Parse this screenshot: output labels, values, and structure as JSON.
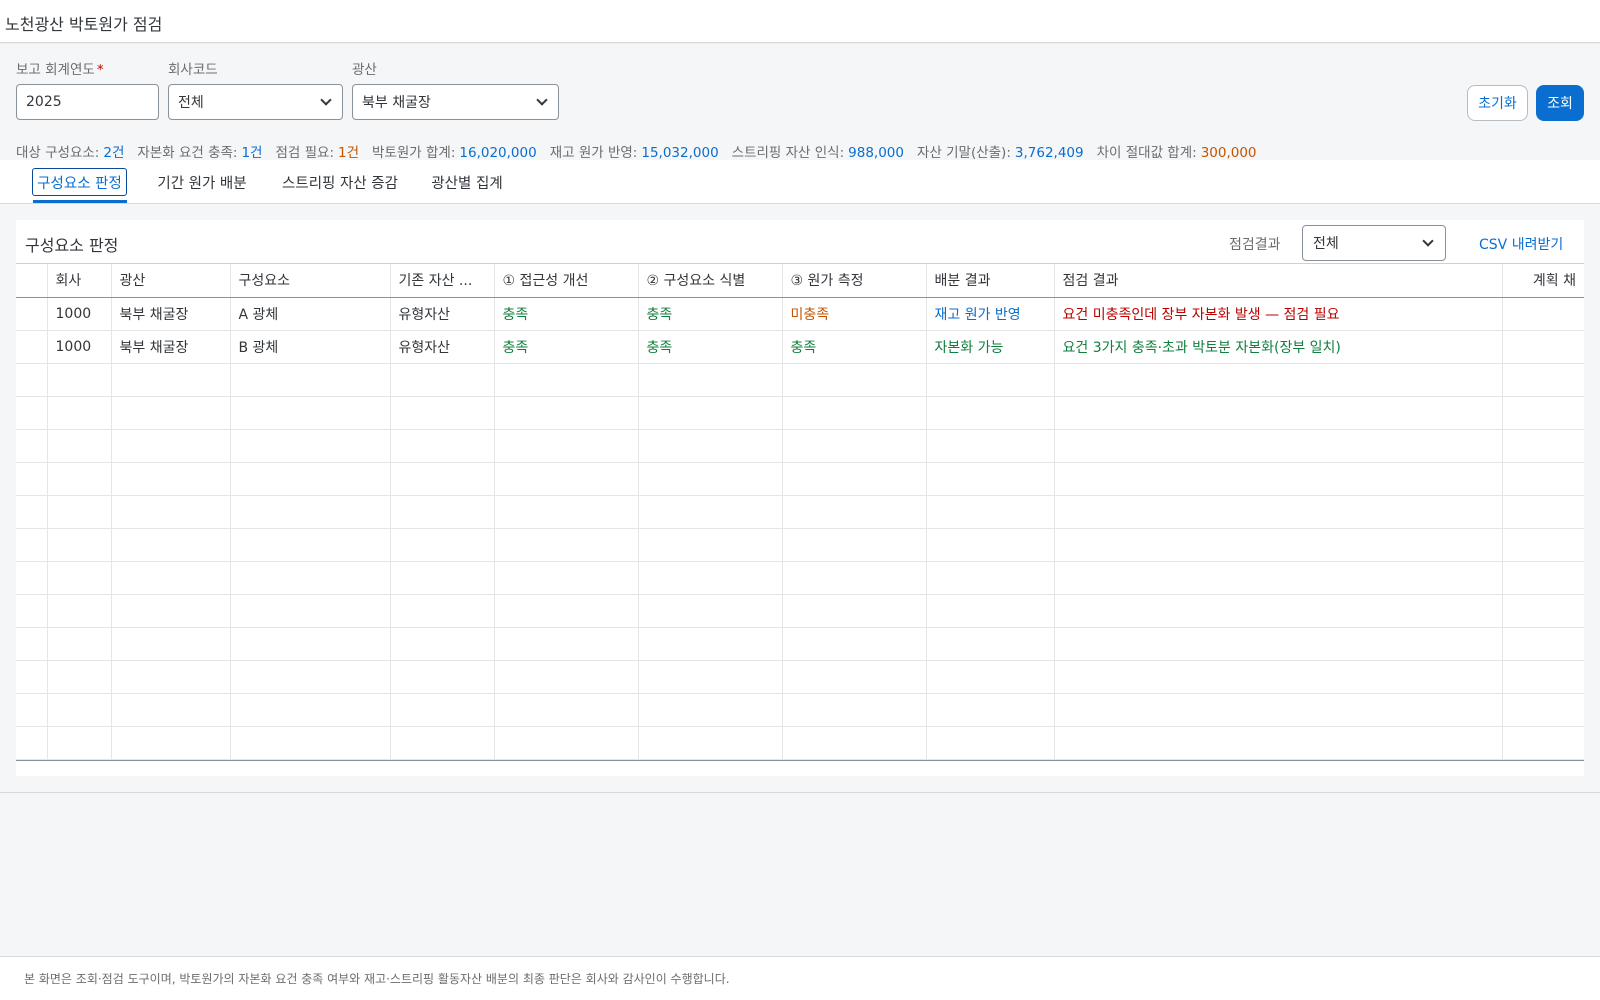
{
  "app": {
    "title": "노천광산 박토원가 점검"
  },
  "filters": {
    "year": {
      "label": "보고 회계연도",
      "required_mark": "*",
      "value": "2025"
    },
    "company": {
      "label": "회사코드",
      "value": "전체"
    },
    "mine": {
      "label": "광산",
      "value": "북부 채굴장"
    }
  },
  "actions": {
    "reset": "초기화",
    "go": "조회"
  },
  "summary": [
    {
      "label": "대상 구성요소:",
      "value": "2건",
      "color": "#0a6ed1"
    },
    {
      "label": "자본화 요건 충족:",
      "value": "1건",
      "color": "#0a6ed1"
    },
    {
      "label": "점검 필요:",
      "value": "1건",
      "color": "#c35500"
    },
    {
      "label": "박토원가 합계:",
      "value": "16,020,000",
      "color": "#0a6ed1"
    },
    {
      "label": "재고 원가 반영:",
      "value": "15,032,000",
      "color": "#0a6ed1"
    },
    {
      "label": "스트리핑 자산 인식:",
      "value": "988,000",
      "color": "#0a6ed1"
    },
    {
      "label": "자산 기말(산출):",
      "value": "3,762,409",
      "color": "#0a6ed1"
    },
    {
      "label": "차이 절대값 합계:",
      "value": "300,000",
      "color": "#c35500"
    }
  ],
  "tabs": [
    {
      "label": "구성요소 판정",
      "active": true
    },
    {
      "label": "기간 원가 배분",
      "active": false
    },
    {
      "label": "스트리핑 자산 증감",
      "active": false
    },
    {
      "label": "광산별 집계",
      "active": false
    }
  ],
  "panel": {
    "title": "구성요소 판정",
    "filter_label": "점검결과",
    "filter_value": "전체",
    "csv": "CSV 내려받기"
  },
  "table": {
    "columns": [
      "",
      "회사",
      "광산",
      "구성요소",
      "기존 자산 ...",
      "① 접근성 개선",
      "② 구성요소 식별",
      "③ 원가 측정",
      "배분 결과",
      "점검 결과",
      "계획 채"
    ],
    "rows": [
      {
        "cells": [
          "",
          "1000",
          "북부 채굴장",
          "A 광체",
          "유형자산",
          "충족",
          "충족",
          "미충족",
          "재고 원가 반영",
          "요건 미충족인데 장부 자본화 발생 — 점검 필요",
          ""
        ]
      },
      {
        "cells": [
          "",
          "1000",
          "북부 채굴장",
          "B 광체",
          "유형자산",
          "충족",
          "충족",
          "충족",
          "자본화 가능",
          "요건 3가지 충족·초과 박토분 자본화(장부 일치)",
          ""
        ]
      }
    ]
  },
  "footer": {
    "note": "본 화면은 조회·점검 도구이며, 박토원가의 자본화 요건 충족 여부와 재고·스트리핑 활동자산 배분의 최종 판단은 회사와 감사인이 수행합니다."
  },
  "colors": {
    "accent": "#0a6ed1",
    "positive": "#107e3e",
    "warning": "#c35500",
    "negative": "#bb0000"
  }
}
